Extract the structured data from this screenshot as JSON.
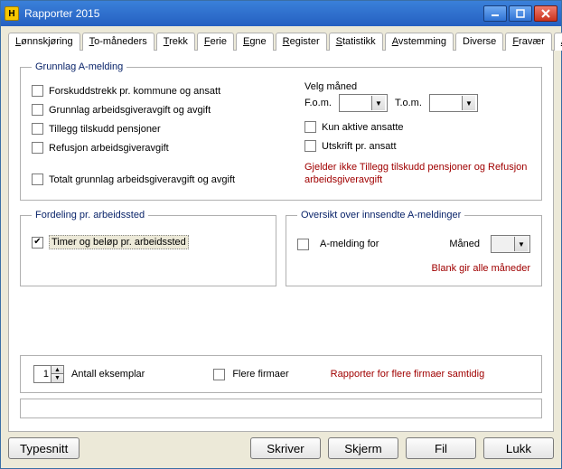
{
  "window": {
    "title": "Rapporter 2015"
  },
  "tabs": [
    {
      "label": "Lønnskjøring",
      "u": 0
    },
    {
      "label": "To-måneders",
      "u": 0
    },
    {
      "label": "Trekk",
      "u": 0
    },
    {
      "label": "Ferie",
      "u": 0
    },
    {
      "label": "Egne",
      "u": 0
    },
    {
      "label": "Register",
      "u": 0
    },
    {
      "label": "Statistikk",
      "u": 0
    },
    {
      "label": "Avstemming",
      "u": 0
    },
    {
      "label": "Diverse",
      "u": -1
    },
    {
      "label": "Fravær",
      "u": 0
    },
    {
      "label": "A-melding",
      "u": 0
    }
  ],
  "grunnlag": {
    "legend": "Grunnlag A-melding",
    "left": {
      "c1": "Forskuddstrekk pr. kommune og ansatt",
      "c2": "Grunnlag arbeidsgiveravgift og avgift",
      "c3": "Tillegg tilskudd pensjoner",
      "c4": "Refusjon arbeidsgiveravgift",
      "c5": "Totalt grunnlag arbeidsgiveravgift og avgift"
    },
    "right": {
      "velg": "Velg måned",
      "fom": "F.o.m.",
      "tom": "T.o.m.",
      "kun": "Kun aktive ansatte",
      "utskrift": "Utskrift pr. ansatt",
      "note": "Gjelder ikke Tillegg tilskudd pensjoner og Refusjon arbeidsgiveravgift"
    }
  },
  "fordeling": {
    "legend": "Fordeling pr. arbeidssted",
    "chk_label": "Timer og beløp pr. arbeidssted",
    "chk_checked": true
  },
  "oversikt": {
    "legend": "Oversikt over innsendte A-meldinger",
    "chk_label": "A-melding for",
    "maned": "Måned",
    "note": "Blank gir alle måneder"
  },
  "copies": {
    "value": "1",
    "label": "Antall eksemplar",
    "flere": "Flere firmaer",
    "note": "Rapporter for flere firmaer samtidig"
  },
  "footer": {
    "typesnitt": "Typesnitt",
    "skriver": "Skriver",
    "skjerm": "Skjerm",
    "fil": "Fil",
    "lukk": "Lukk"
  }
}
